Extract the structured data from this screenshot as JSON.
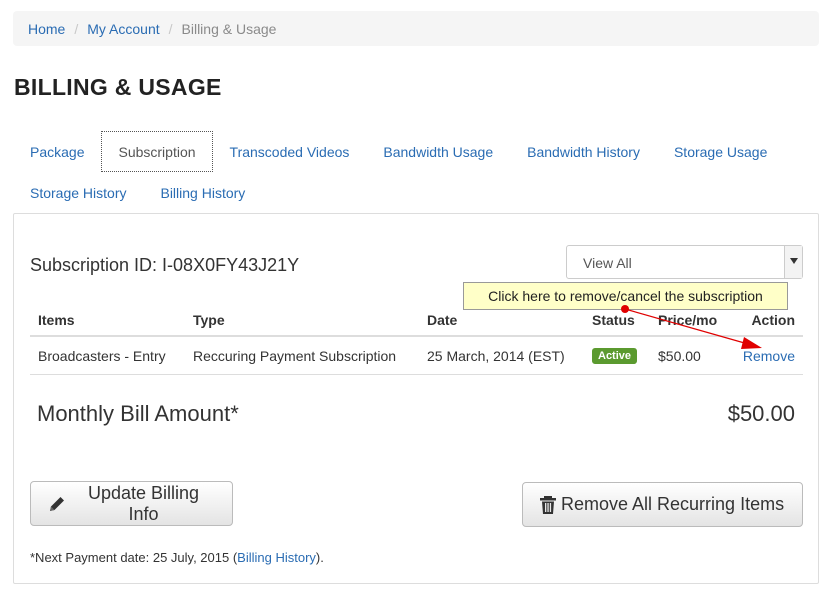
{
  "breadcrumb": {
    "items": [
      {
        "label": "Home"
      },
      {
        "label": "My Account"
      },
      {
        "label": "Billing & Usage"
      }
    ],
    "separator": "/"
  },
  "page_title": "BILLING & USAGE",
  "tabs": {
    "row1": [
      "Package",
      "Subscription",
      "Transcoded Videos",
      "Bandwidth Usage",
      "Bandwidth History",
      "Storage Usage"
    ],
    "row2": [
      "Storage History",
      "Billing History"
    ],
    "active": "Subscription"
  },
  "subscription": {
    "id_text": "Subscription ID: I-08X0FY43J21Y",
    "filter_value": "View All"
  },
  "table": {
    "headers": [
      "Items",
      "Type",
      "Date",
      "Status",
      "Price/mo",
      "Action"
    ],
    "rows": [
      {
        "item": "Broadcasters - Entry",
        "type": "Reccuring Payment Subscription",
        "date": "25 March, 2014 (EST)",
        "status": "Active",
        "price": "$50.00",
        "action": "Remove"
      }
    ]
  },
  "total": {
    "label": "Monthly Bill Amount*",
    "value": "$50.00"
  },
  "buttons": {
    "update_billing": "Update Billing Info",
    "remove_all": "Remove All Recurring Items"
  },
  "footer": {
    "prefix": "*Next Payment date: 25 July, 2015 (",
    "link": "Billing History",
    "suffix": ")."
  },
  "tooltip": {
    "text": "Click here to remove/cancel the subscription"
  },
  "colors": {
    "link": "#2a6cb3",
    "status_active": "#5b9a2f",
    "tooltip_bg": "#ffffc8",
    "annotation_arrow": "#e00000"
  },
  "icons": {
    "filter_dropdown": "chevron-down-icon",
    "update_button": "pencil-icon",
    "remove_all_button": "trash-icon"
  }
}
